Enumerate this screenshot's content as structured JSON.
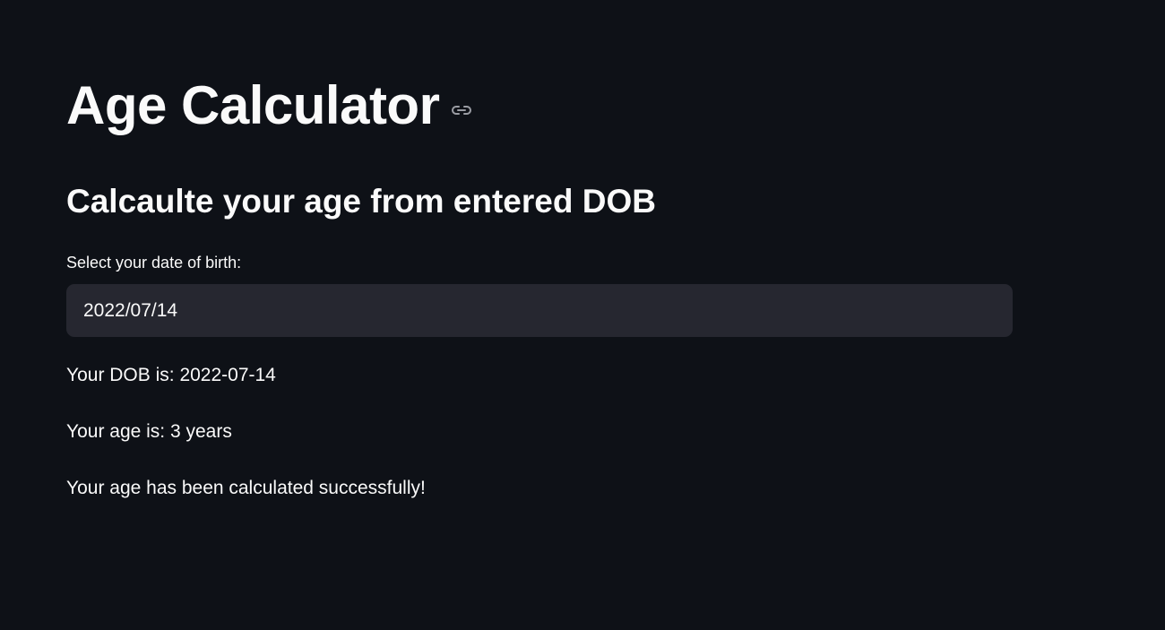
{
  "header": {
    "title": "Age Calculator",
    "anchor_icon": "link-icon"
  },
  "main": {
    "subtitle": "Calcaulte your age from entered DOB",
    "dob_input": {
      "label": "Select your date of birth:",
      "value": "2022/07/14"
    },
    "results": {
      "dob_text": "Your DOB is: 2022-07-14",
      "age_text": "Your age is: 3 years",
      "success_text": "Your age has been calculated successfully!"
    }
  },
  "colors": {
    "background": "#0e1117",
    "text": "#fafafa",
    "input_background": "#262730"
  }
}
